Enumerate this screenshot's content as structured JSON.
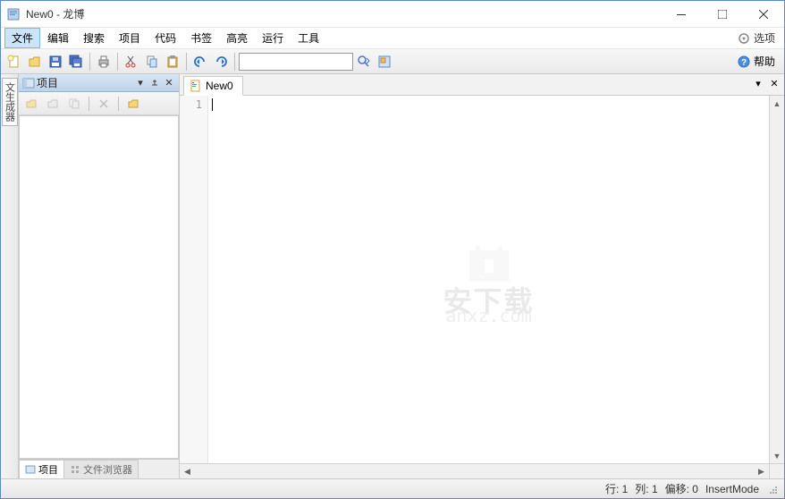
{
  "title": "New0 - 龙博",
  "menu": {
    "file": "文件",
    "edit": "编辑",
    "search": "搜索",
    "project": "项目",
    "code": "代码",
    "bookmark": "书签",
    "highlight": "高亮",
    "run": "运行",
    "tools": "工具",
    "options": "选项"
  },
  "toolbar": {
    "search_value": "",
    "help": "帮助"
  },
  "dock": {
    "generator": "文生成器"
  },
  "sidebar": {
    "title": "项目",
    "tabs": {
      "project": "项目",
      "browser": "文件浏览器"
    }
  },
  "editor": {
    "tab": "New0",
    "line1": "1"
  },
  "status": {
    "row": "行: 1",
    "col": "列: 1",
    "offset": "偏移: 0",
    "mode": "InsertMode"
  },
  "watermark": {
    "line1": "安下载",
    "line2": "anxz.com"
  }
}
